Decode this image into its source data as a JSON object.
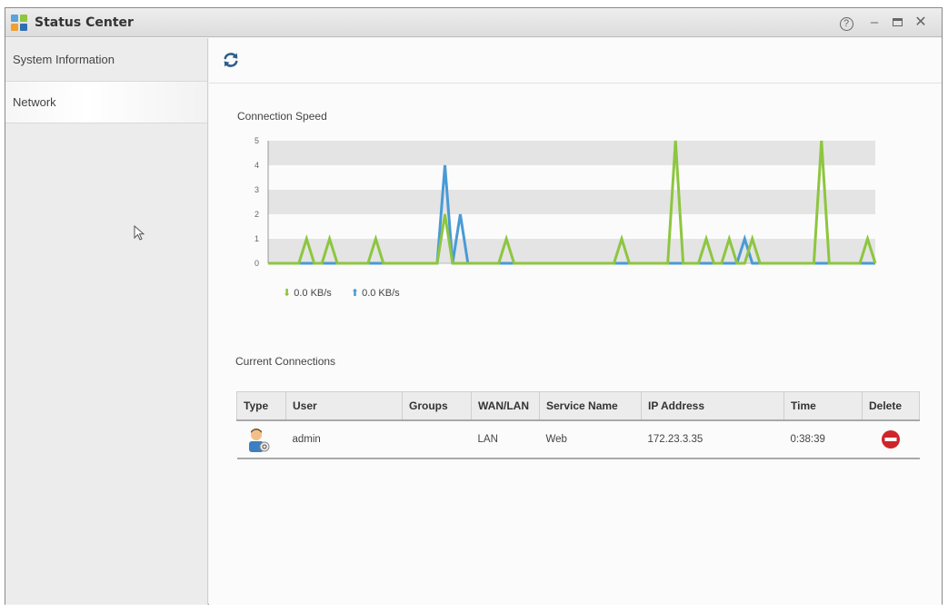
{
  "window": {
    "title": "Status Center"
  },
  "sidebar": {
    "items": [
      {
        "label": "System Information"
      },
      {
        "label": "Network"
      }
    ]
  },
  "speed": {
    "title": "Connection Speed",
    "download_label": "0.0 KB/s",
    "upload_label": "0.0 KB/s",
    "download_color": "#8dc63f",
    "upload_color": "#4a9ad6"
  },
  "chart_data": {
    "type": "line",
    "title": "Connection Speed",
    "yticks": [
      "0",
      "1",
      "2",
      "3",
      "4",
      "5"
    ],
    "ylim": [
      0,
      5
    ],
    "x": [
      0,
      1,
      2,
      3,
      4,
      5,
      6,
      7,
      8,
      9,
      10,
      11,
      12,
      13,
      14,
      15,
      16,
      17,
      18,
      19,
      20,
      21,
      22,
      23,
      24,
      25,
      26,
      27,
      28,
      29,
      30,
      31,
      32,
      33,
      34,
      35,
      36,
      37,
      38,
      39,
      40,
      41,
      42,
      43,
      44,
      45,
      46,
      47,
      48,
      49,
      50,
      51,
      52,
      53,
      54,
      55,
      56,
      57,
      58,
      59,
      60,
      61,
      62,
      63,
      64,
      65,
      66,
      67,
      68,
      69,
      70,
      71,
      72,
      73,
      74,
      75,
      76,
      77,
      78,
      79
    ],
    "series": [
      {
        "color": "#4a9ad6",
        "values": [
          0,
          0,
          0,
          0,
          0,
          0,
          0,
          0,
          0,
          0,
          0,
          0,
          0,
          0,
          0,
          0,
          0,
          0,
          0,
          0,
          0,
          0,
          0,
          4,
          0,
          2,
          0,
          0,
          0,
          0,
          0,
          0,
          0,
          0,
          0,
          0,
          0,
          0,
          0,
          0,
          0,
          0,
          0,
          0,
          0,
          0,
          0,
          0,
          0,
          0,
          0,
          0,
          0,
          0,
          0,
          0,
          0,
          0,
          0,
          0,
          0,
          0,
          1,
          0,
          0,
          0,
          0,
          0,
          0,
          0,
          0,
          0,
          0,
          0,
          0,
          0,
          0,
          0,
          0,
          0
        ]
      },
      {
        "color": "#8dc63f",
        "values": [
          0,
          0,
          0,
          0,
          0,
          1,
          0,
          0,
          1,
          0,
          0,
          0,
          0,
          0,
          1,
          0,
          0,
          0,
          0,
          0,
          0,
          0,
          0,
          2,
          0,
          0,
          0,
          0,
          0,
          0,
          0,
          1,
          0,
          0,
          0,
          0,
          0,
          0,
          0,
          0,
          0,
          0,
          0,
          0,
          0,
          0,
          1,
          0,
          0,
          0,
          0,
          0,
          0,
          5,
          0,
          0,
          0,
          1,
          0,
          0,
          1,
          0,
          0,
          1,
          0,
          0,
          0,
          0,
          0,
          0,
          0,
          0,
          5,
          0,
          0,
          0,
          0,
          0,
          1,
          0
        ]
      }
    ],
    "band_color": "#e4e4e4"
  },
  "connections": {
    "title": "Current Connections",
    "columns": [
      "Type",
      "User",
      "Groups",
      "WAN/LAN",
      "Service Name",
      "IP Address",
      "Time",
      "Delete"
    ],
    "rows": [
      {
        "user": "admin",
        "groups": "",
        "wan_lan": "LAN",
        "service": "Web",
        "ip": "172.23.3.35",
        "time": "0:38:39"
      }
    ]
  }
}
